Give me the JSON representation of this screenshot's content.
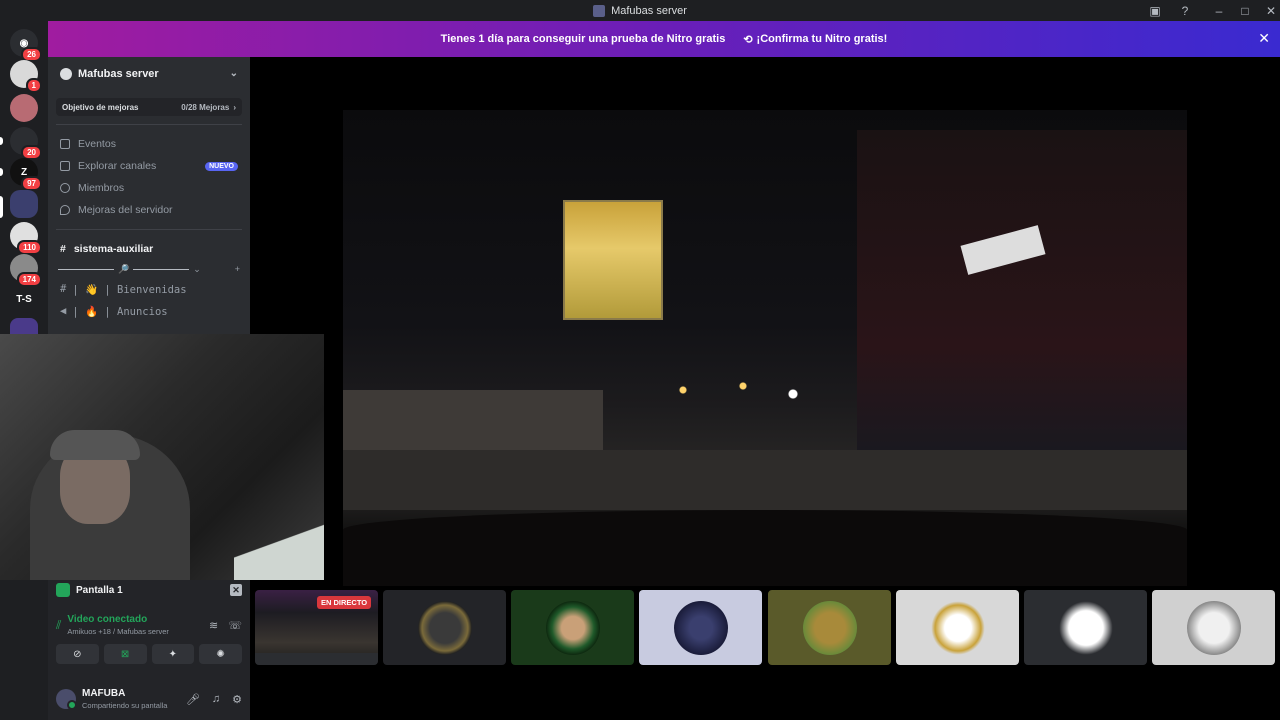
{
  "window": {
    "title": "Mafubas server"
  },
  "nitro_banner": {
    "text": "Tienes 1 día para conseguir una prueba de Nitro gratis",
    "cta": "¡Confirma tu Nitro gratis!"
  },
  "servers": [
    {
      "label": "",
      "badge": "26"
    },
    {
      "label": "",
      "badge": "1"
    },
    {
      "label": "",
      "badge": ""
    },
    {
      "label": "",
      "badge": "20"
    },
    {
      "label": "Z",
      "badge": "97"
    },
    {
      "label": "",
      "badge": ""
    },
    {
      "label": "",
      "badge": "110"
    },
    {
      "label": "",
      "badge": "174"
    },
    {
      "label": "T-S",
      "badge": ""
    }
  ],
  "sidebar": {
    "server_name": "Mafubas server",
    "boost": {
      "label": "Objetivo de mejoras",
      "count": "0/28 Mejoras"
    },
    "nav": [
      {
        "label": "Eventos"
      },
      {
        "label": "Explorar canales",
        "badge": "NUEVO"
      },
      {
        "label": "Miembros"
      },
      {
        "label": "Mejoras del servidor"
      }
    ],
    "category": "sistema-auxiliar",
    "channels": [
      {
        "label": "| 👋 | Bienvenidas"
      },
      {
        "label": "| 🔥 | Anuncios"
      }
    ]
  },
  "voice_panel": {
    "title": "Pantalla 1",
    "status": "Video conectado",
    "sub": "Amikuos +18 / Mafubas server"
  },
  "user": {
    "name": "MAFUBA",
    "status": "Compartiendo su pantalla"
  },
  "thumbnails": {
    "live_label": "EN DIRECTO"
  }
}
